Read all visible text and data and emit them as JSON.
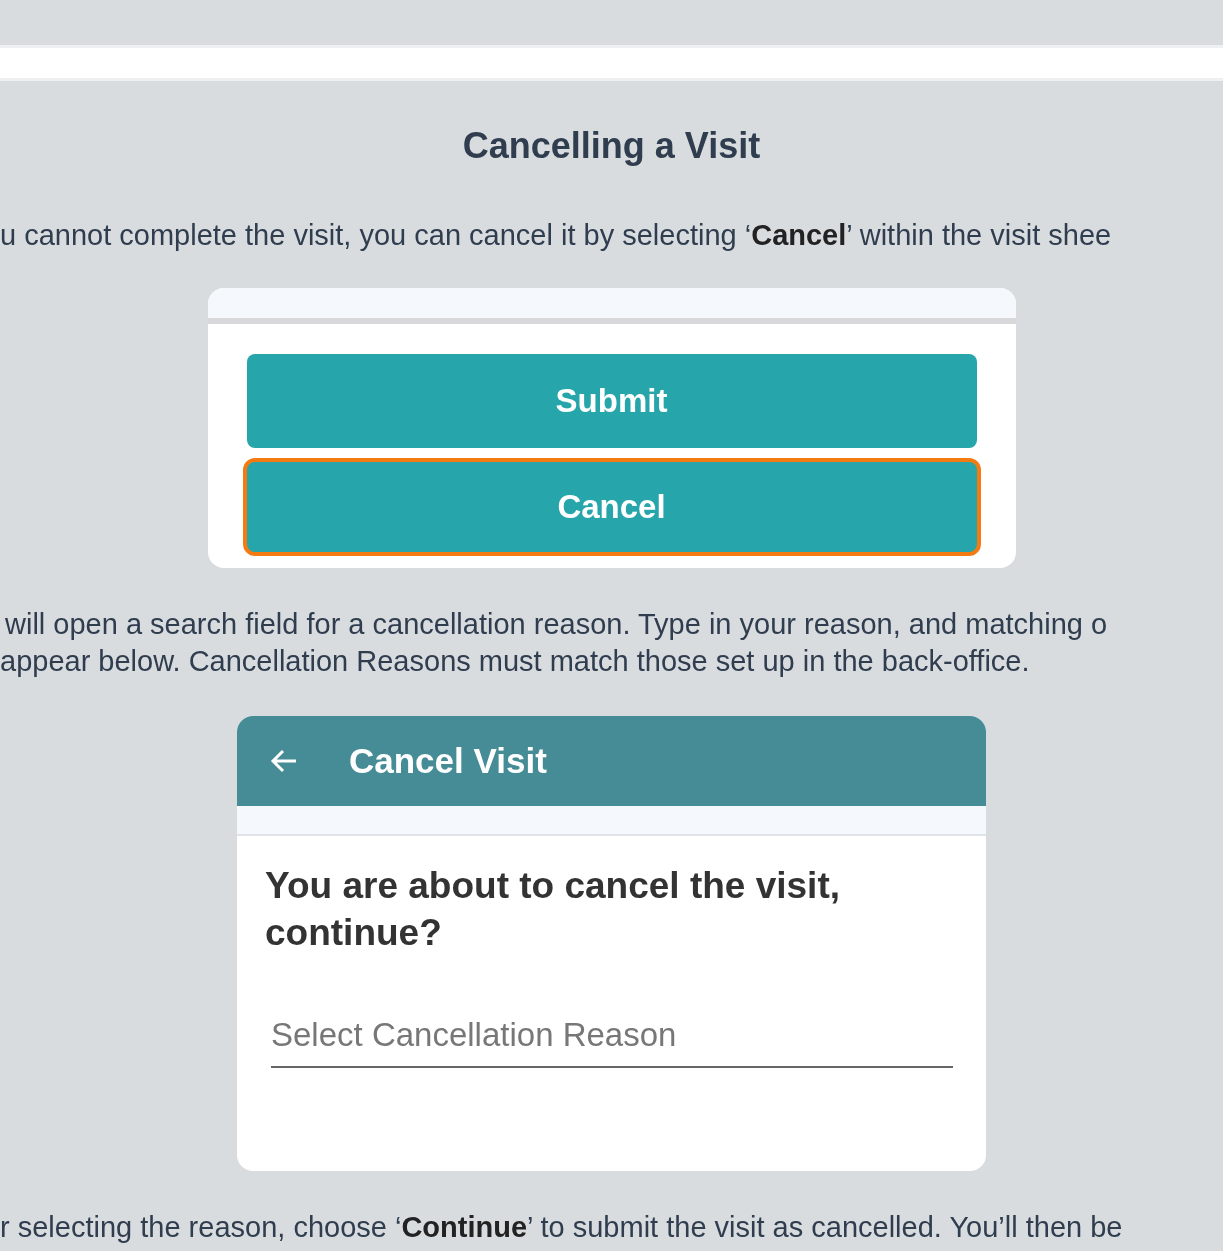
{
  "heading": "Cancelling a Visit",
  "paragraphs": [
    "u cannot complete the visit, you can cancel it by selecting ‘**Cancel**’ within the visit shee",
    " will open a search field for a cancellation reason. Type in your reason, and matching o",
    "appear below. Cancellation Reasons must match those set up in the back-office.",
    "r selecting the reason, choose ‘**Continue**’ to submit the visit as cancelled. You’ll then be"
  ],
  "button_sheet": {
    "buttons": [
      {
        "label": "Submit",
        "highlighted": false
      },
      {
        "label": "Cancel",
        "highlighted": true
      }
    ]
  },
  "cancel_dialog": {
    "title": "Cancel Visit",
    "question": "You are about to cancel the visit, continue?",
    "reason_field": {
      "placeholder": "Select Cancellation Reason"
    }
  }
}
